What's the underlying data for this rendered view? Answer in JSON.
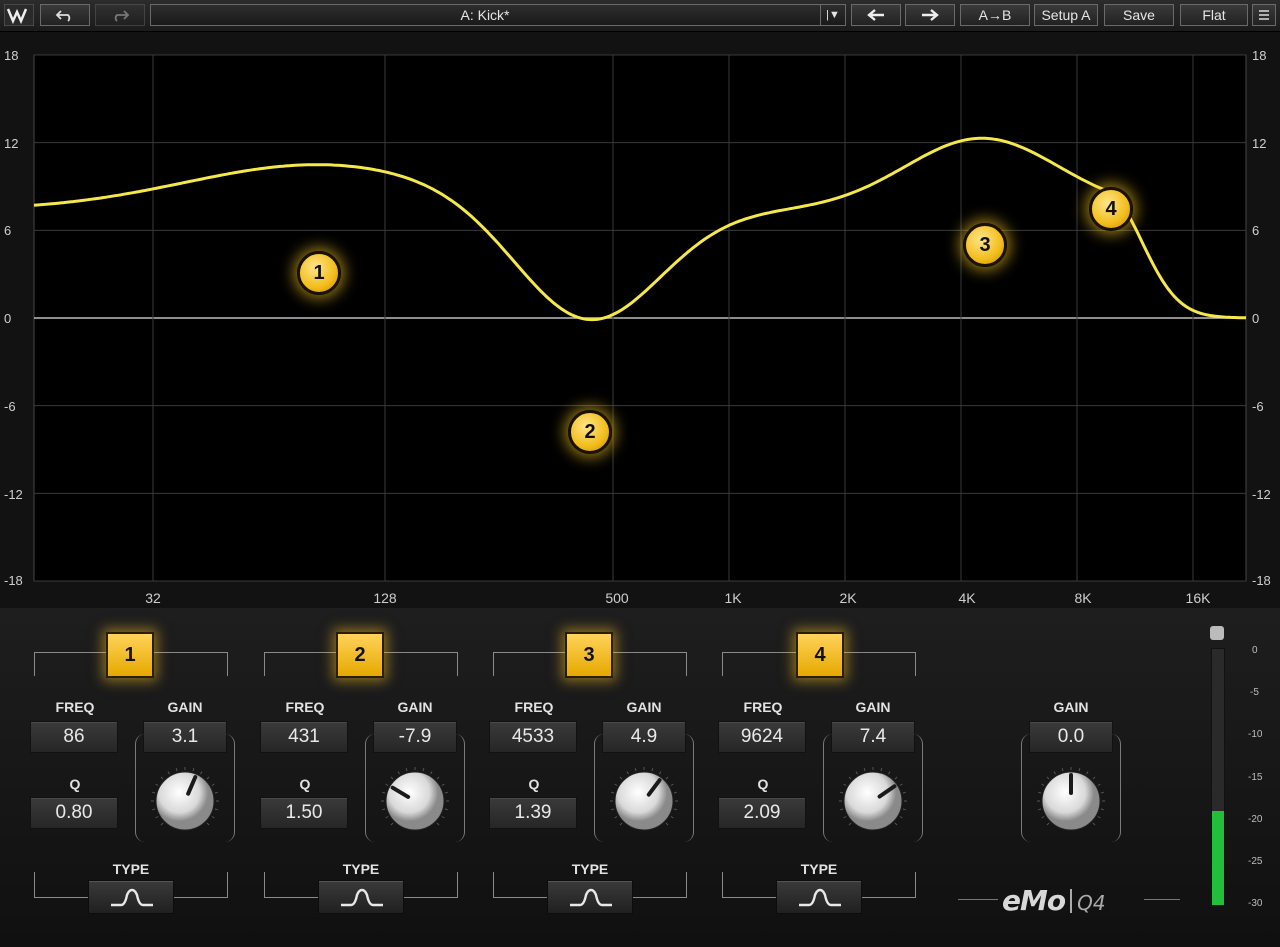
{
  "toolbar": {
    "undo_icon": "undo-icon",
    "redo_icon": "redo-icon",
    "preset_name": "A: Kick*",
    "preset_dropdown_icon": "chevron-down-icon",
    "prev_icon": "arrow-left-icon",
    "next_icon": "arrow-right-icon",
    "ab_label": "A→B",
    "setup_label": "Setup A",
    "save_label": "Save",
    "flat_label": "Flat",
    "menu_icon": "menu-icon"
  },
  "graph": {
    "db_ticks": [
      "18",
      "12",
      "6",
      "0",
      "-6",
      "-12",
      "-18"
    ],
    "freq_ticks": [
      "32",
      "128",
      "500",
      "1K",
      "2K",
      "4K",
      "8K",
      "16K"
    ],
    "curve_color": "#f5e84a",
    "nodes": [
      {
        "label": "1",
        "freq": 86,
        "gain": 3.1
      },
      {
        "label": "2",
        "freq": 431,
        "gain": -7.9
      },
      {
        "label": "3",
        "freq": 4533,
        "gain": 4.9
      },
      {
        "label": "4",
        "freq": 9624,
        "gain": 7.4
      }
    ]
  },
  "bands": [
    {
      "number": "1",
      "freq_label": "FREQ",
      "freq": "86",
      "gain_label": "GAIN",
      "gain": "3.1",
      "q_label": "Q",
      "q": "0.80",
      "type_label": "TYPE",
      "type_icon": "bell-filter-icon"
    },
    {
      "number": "2",
      "freq_label": "FREQ",
      "freq": "431",
      "gain_label": "GAIN",
      "gain": "-7.9",
      "q_label": "Q",
      "q": "1.50",
      "type_label": "TYPE",
      "type_icon": "bell-filter-icon"
    },
    {
      "number": "3",
      "freq_label": "FREQ",
      "freq": "4533",
      "gain_label": "GAIN",
      "gain": "4.9",
      "q_label": "Q",
      "q": "1.39",
      "type_label": "TYPE",
      "type_icon": "bell-filter-icon"
    },
    {
      "number": "4",
      "freq_label": "FREQ",
      "freq": "9624",
      "gain_label": "GAIN",
      "gain": "7.4",
      "q_label": "Q",
      "q": "2.09",
      "type_label": "TYPE",
      "type_icon": "bell-filter-icon"
    }
  ],
  "output": {
    "gain_label": "GAIN",
    "gain": "0.0",
    "meter_scale": [
      "0",
      "-5",
      "-10",
      "-15",
      "-20",
      "-25",
      "-30"
    ],
    "meter_level_db": -19,
    "meter_color": "#22c03a"
  },
  "brand": {
    "logo_text": "eMo",
    "model": "Q4"
  }
}
